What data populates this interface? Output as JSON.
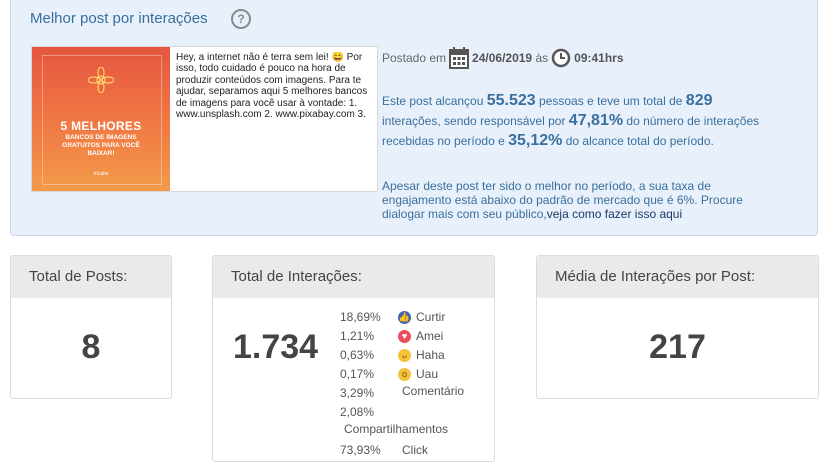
{
  "best_post": {
    "title": "Melhor post por interações",
    "help_icon": "question-circle-icon",
    "post_text": "Hey, a internet não é terra sem lei! 😀 Por isso, todo cuidado é pouco na hora de produzir conteúdos com imagens. Para te ajudar, separamos aqui 5 melhores bancos de imagens para você usar à vontade: 1. www.unsplash.com 2. www.pixabay.com 3.",
    "thumbnail": {
      "title": "5 MELHORES",
      "subtitle": "BANCOS DE IMAGENS GRATUITOS PARA VOCÊ BAIXAR!",
      "logo": "mLabs"
    },
    "posted_prefix": "Postado em",
    "posted_date": "24/06/2019",
    "posted_at": "às",
    "posted_time": "09:41hrs",
    "stats": {
      "s1": "Este post alcançou",
      "reach": "55.523",
      "s2": "pessoas e teve um total de",
      "interactions": "829",
      "s3": "interações, sendo responsável por",
      "interactions_share": "47,81%",
      "s4": "do número de interações recebidas no período e",
      "reach_share": "35,12%",
      "s5": "do alcance total do período."
    },
    "warning": {
      "text": "Apesar deste post ter sido o melhor no período, a sua taxa de engajamento está abaixo do padrão de mercado que é 6%. Procure dialogar mais com seu público,",
      "link": "veja como fazer isso aqui"
    }
  },
  "cards": {
    "posts": {
      "label": "Total de Posts:",
      "value": "8"
    },
    "interactions": {
      "label": "Total de Interações:",
      "value": "1.734",
      "breakdown": [
        {
          "pct": "18,69%",
          "label": "Curtir",
          "icon": "like-icon"
        },
        {
          "pct": "1,21%",
          "label": "Amei",
          "icon": "love-icon"
        },
        {
          "pct": "0,63%",
          "label": "Haha",
          "icon": "haha-icon"
        },
        {
          "pct": "0,17%",
          "label": "Uau",
          "icon": "wow-icon"
        },
        {
          "pct": "3,29%",
          "label": "Comentário"
        },
        {
          "pct": "2,08%",
          "label": "Compartilhamentos"
        },
        {
          "pct": "73,93%",
          "label": "Click"
        }
      ]
    },
    "average": {
      "label": "Média de Interações por Post:",
      "value": "217"
    }
  }
}
